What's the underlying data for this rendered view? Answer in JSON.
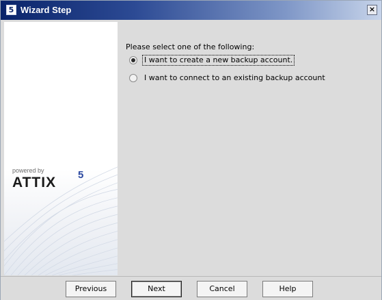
{
  "window": {
    "title": "Wizard Step",
    "icon_glyph": "5",
    "close_glyph": "×"
  },
  "branding": {
    "powered_by": "powered by",
    "logo_text": "ATTIX",
    "logo_superscript": "5",
    "logo_accent_color": "#2b48a0"
  },
  "form": {
    "prompt": "Please select one of the following:",
    "options": [
      {
        "label": "I want to create a new backup account.",
        "selected": true
      },
      {
        "label": "I want to connect to an existing backup account",
        "selected": false
      }
    ]
  },
  "buttons": {
    "previous": "Previous",
    "next": "Next",
    "cancel": "Cancel",
    "help": "Help"
  },
  "colors": {
    "titlebar_start": "#0a246a",
    "titlebar_end": "#c7d4ea",
    "window_background": "#dcdcdc"
  }
}
